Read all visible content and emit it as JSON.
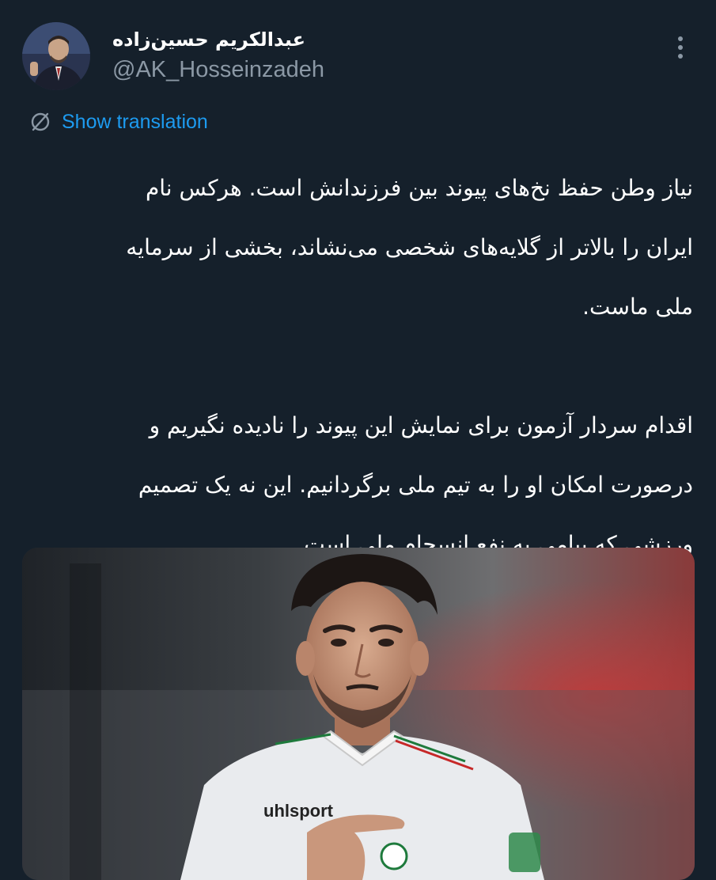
{
  "author": {
    "display_name": "عبدالکریم حسین‌زاده",
    "handle": "@AK_Hosseinzadeh",
    "avatar_icon": "profile-photo"
  },
  "actions": {
    "more_icon": "more-vertical-icon",
    "translate_icon": "globe-icon",
    "translate_label": "Show translation"
  },
  "tweet": {
    "paragraph_1_lines": [
      "نیاز وطن حفظ نخ‌های پیوند بین فرزندانش است. هرکس نام",
      "ایران را بالاتر از گلایه‌های شخصی می‌نشاند، بخشی از سرمایه",
      "ملی ماست."
    ],
    "paragraph_2_lines": [
      "اقدام سردار آزمون برای نمایش این پیوند را نادیده نگیریم و",
      "درصورت امکان او را به تیم ملی برگردانیم. این نه یک تصمیم",
      "ورزشی که پیامی به نفع انسجام ملی است."
    ]
  },
  "media": {
    "kit_text": "uhlsport"
  },
  "colors": {
    "background": "#15202b",
    "primary_text": "#ffffff",
    "secondary_text": "#8b98a5",
    "link": "#1d9bf0"
  }
}
